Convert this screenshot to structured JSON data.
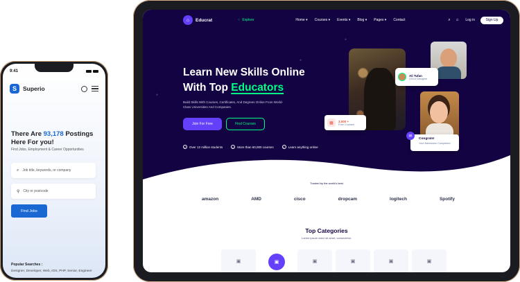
{
  "colors": {
    "phone_accent": "#1967d2",
    "tablet_hero_bg": "#140342",
    "tablet_primary": "#6440fb",
    "tablet_accent": "#00ff84"
  },
  "phone": {
    "status_time": "9:41",
    "brand": "Superio",
    "title_prefix": "There Are ",
    "title_count": "93,178",
    "title_suffix": " Postings Here For you!",
    "subtitle": "Find Jobs, Employment & Career Opportunities",
    "search_placeholder": "Job title, keywords, or company",
    "location_placeholder": "City or postcode",
    "find_button": "Find Jobs",
    "popular_label": "Popular Searches :",
    "popular_items": "Designer, Developer, Web, IOS, PHP, Senior, Engineer",
    "icons": [
      "user-icon",
      "hamburger-menu-icon",
      "search-icon",
      "map-pin-icon"
    ]
  },
  "tablet": {
    "brand": "Educrat",
    "explore": "Explore",
    "menu": [
      "Home ▾",
      "Courses ▾",
      "Events ▾",
      "Blog ▾",
      "Pages ▾",
      "Contact"
    ],
    "login": "Log in",
    "signup": "Sign Up",
    "hero": {
      "title_line1": "Learn New Skills Online",
      "title_line2_prefix": "With Top ",
      "title_accent": "Educators",
      "subtitle": "Build Skills With Courses, Certificates, And Degrees Online From World-Class Universities And Companies.",
      "btn_primary": "Join For Free",
      "btn_secondary": "Find Courses",
      "features": [
        "Over 12 million students",
        "More than 60,000 courses",
        "Learn anything online"
      ]
    },
    "cards": {
      "tutor_name": "Ali Tufan",
      "tutor_role": "UX/UI Designer",
      "courses_value": "3,000 +",
      "courses_label": "Free Courses",
      "congrats_title": "Congrats!",
      "congrats_sub": "Your Admission Completed"
    },
    "trusted_label": "Trusted by the world's best",
    "logos": [
      "amazon",
      "AMD",
      "cisco",
      "dropcam",
      "logitech",
      "Spotify"
    ],
    "categories_title": "Top Categories",
    "categories_sub": "Lorem ipsum dolor sit amet, consectetur.",
    "category_icons": [
      "briefcase-icon",
      "briefcase-icon",
      "briefcase-icon",
      "briefcase-icon",
      "briefcase-icon",
      "briefcase-icon"
    ]
  }
}
